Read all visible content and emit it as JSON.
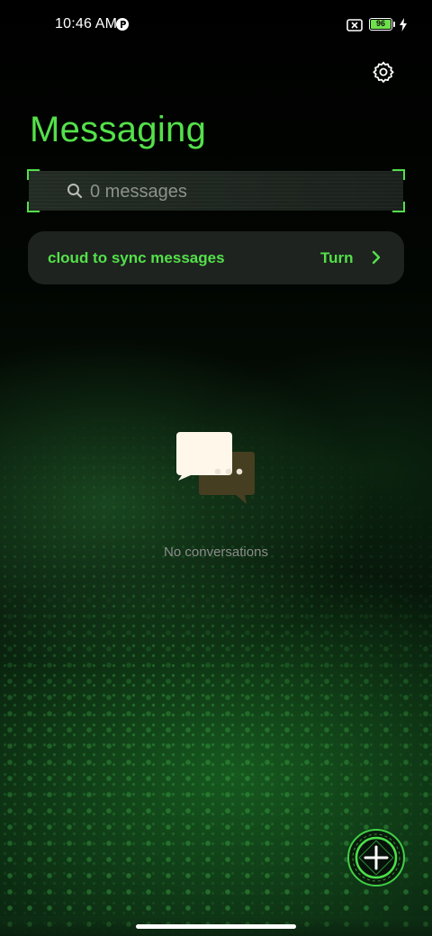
{
  "status_bar": {
    "time": "10:46 AM",
    "battery_level": "96",
    "icons": [
      "app-notification-icon",
      "sim-off-icon",
      "battery-icon",
      "charging-bolt-icon"
    ]
  },
  "header": {
    "title": "Messaging",
    "settings_icon": "gear-icon"
  },
  "search": {
    "placeholder": "0 messages",
    "icon": "search-icon"
  },
  "sync_banner": {
    "text": "cloud to sync messages",
    "action_label": "Turn",
    "icon": "chevron-right-icon"
  },
  "empty_state": {
    "icon": "chat-bubbles-icon",
    "text": "No conversations"
  },
  "fab": {
    "icon": "plus-icon"
  },
  "colors": {
    "accent": "#54e04a",
    "background": "#000000",
    "battery_fill": "#6fe04c"
  }
}
